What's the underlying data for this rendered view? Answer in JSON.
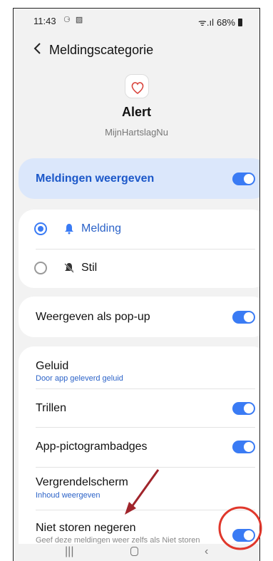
{
  "status": {
    "time": "11:43",
    "left_icons": "⚆ ▨",
    "signal": "ᯤ.ıl",
    "battery": "68%"
  },
  "header": {
    "title": "Meldingscategorie"
  },
  "app": {
    "name": "Alert",
    "package": "MijnHartslagNu",
    "icon_text": "hart slag"
  },
  "main_toggle": {
    "label": "Meldingen weergeven",
    "on": true
  },
  "alert_types": [
    {
      "label": "Melding",
      "selected": true,
      "icon": "bell-icon"
    },
    {
      "label": "Stil",
      "selected": false,
      "icon": "bell-off-icon"
    }
  ],
  "popup": {
    "label": "Weergeven als pop-up",
    "on": true
  },
  "settings": {
    "sound": {
      "label": "Geluid",
      "sub": "Door app geleverd geluid"
    },
    "vibrate": {
      "label": "Trillen",
      "on": true
    },
    "badges": {
      "label": "App-pictogrambadges",
      "on": true
    },
    "lockscreen": {
      "label": "Vergrendelscherm",
      "sub": "Inhoud weergeven"
    },
    "dnd": {
      "label": "Niet storen negeren",
      "sub": "Geef deze meldingen weer zelfs als Niet storen",
      "on": true
    }
  },
  "colors": {
    "accent": "#3a7bf4",
    "annotation": "#e0372b",
    "arrow": "#a0242b"
  }
}
